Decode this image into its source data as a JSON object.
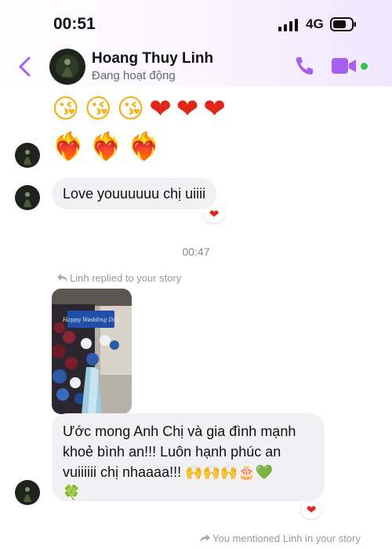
{
  "status_bar": {
    "time": "00:51",
    "network": "4G"
  },
  "header": {
    "contact_name": "Hoang Thuy Linh",
    "contact_status": "Đang hoạt động"
  },
  "messages": {
    "emoji_row_1": [
      "😘",
      "😘",
      "😘",
      "❤",
      "❤",
      "❤"
    ],
    "emoji_row_2": [
      "❤‍🔥",
      "❤‍🔥",
      "❤‍🔥"
    ],
    "text_1": "Love youuuuuu chị uiiii",
    "reaction_1": "❤",
    "time_divider": "00:47",
    "story_reply_note": "Linh replied to your story",
    "story_text": "Happy Wedding Day",
    "text_2_line_1": "Ước mong Anh Chị và gia đình mạnh",
    "text_2_line_2": "khoẻ bình an!!! Luôn hạnh phúc an",
    "text_2_line_3": "vuiiiiii chị nhaaaa!!! 🙌🙌🙌🎂💚",
    "text_2_line_4": "🍀",
    "reaction_2": "❤",
    "mention_note": "You mentioned Linh in your story"
  },
  "colors": {
    "accent": "#a55df2",
    "online": "#31c24d",
    "bubble": "#f1f0f3",
    "heart": "#e0261b"
  },
  "icons": [
    "back-chevron-icon",
    "phone-icon",
    "video-camera-icon",
    "reply-arrow-icon",
    "forward-arrow-icon"
  ]
}
